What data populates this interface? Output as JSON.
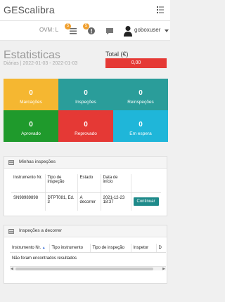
{
  "app": {
    "title": "GEScalibra"
  },
  "header": {
    "ovm": "OVM: L",
    "tasks_badge": "5",
    "alerts_badge": "5",
    "username": "goboxuser"
  },
  "page": {
    "title": "Estatisticas",
    "subtitle": "Diárias  |  2022-01-03 - 2022-01-03",
    "total_label": "Total (€)",
    "total_value": "0,00"
  },
  "tiles": [
    {
      "value": "0",
      "label": "Marcações",
      "color": "#f5b731"
    },
    {
      "value": "0",
      "label": "Inspeções",
      "color": "#2a9d9a"
    },
    {
      "value": "0",
      "label": "Reinspeções",
      "color": "#2a9d9a"
    },
    {
      "value": "0",
      "label": "Aprovado",
      "color": "#1f9a2c"
    },
    {
      "value": "0",
      "label": "Reprovado",
      "color": "#e53935"
    },
    {
      "value": "0",
      "label": "Em espera",
      "color": "#1fb6d9"
    }
  ],
  "my_inspections": {
    "title": "Minhas inspeções",
    "columns": [
      "Instrumento Nr.",
      "Tipo de inspeção",
      "Estado",
      "Data de início",
      ""
    ],
    "rows": [
      {
        "instrument": "SN98989898",
        "type": "DTPT081, Ed. 3",
        "state": "A decorrer",
        "start": "2021-12-23 18:37",
        "action": "Continuar"
      }
    ]
  },
  "ongoing": {
    "title": "Inspeções a decorrer",
    "columns": [
      "Instrumento Nr.",
      "Tipo instrumento",
      "Tipo de inspeção",
      "Inspetor",
      "D"
    ],
    "empty": "Não foram encontrados resultados"
  }
}
